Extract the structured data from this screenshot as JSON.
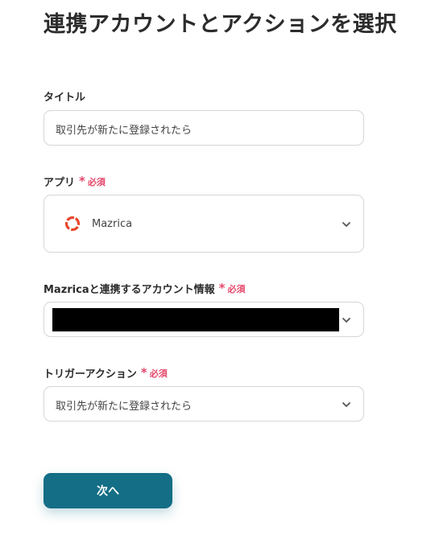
{
  "page": {
    "title": "連携アカウントとアクションを選択"
  },
  "form": {
    "title_field": {
      "label": "タイトル",
      "value": "取引先が新たに登録されたら"
    },
    "app_field": {
      "label": "アプリ",
      "required_label": "必須",
      "value": "Mazrica",
      "icon": "mazrica-logo-icon"
    },
    "account_field": {
      "label": "Mazricaと連携するアカウント情報",
      "required_label": "必須"
    },
    "trigger_field": {
      "label": "トリガーアクション",
      "required_label": "必須",
      "value": "取引先が新たに登録されたら"
    },
    "next_button": {
      "label": "次へ"
    }
  },
  "colors": {
    "accent": "#136e86",
    "required": "#e5486b",
    "border": "#d6d6d6"
  }
}
